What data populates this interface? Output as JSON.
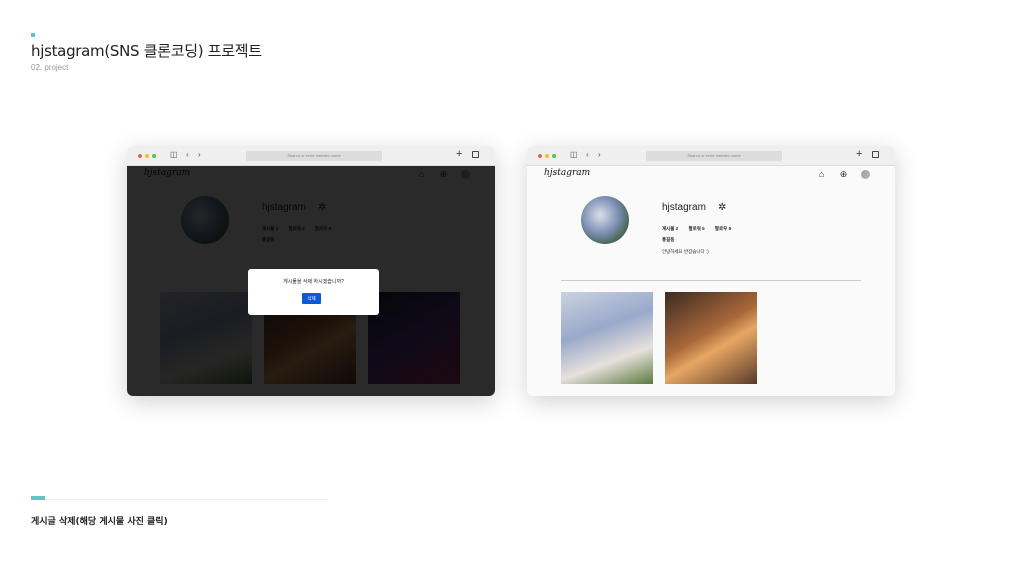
{
  "page": {
    "title": "hjstagram(SNS 클론코딩) 프로젝트",
    "subtitle": "02. project",
    "caption": "게시글 삭제(해당 게시물 사진 클릭)"
  },
  "browser": {
    "url_placeholder": "Search or enter website name"
  },
  "app": {
    "logo": "hjstagram",
    "username": "hjstagram",
    "name": "홍길동",
    "bio": "안녕하세요 반갑습니다 :)"
  },
  "left_window": {
    "stats": [
      "게시물 3",
      "팔로워 4",
      "팔로우 5"
    ],
    "name": "홍길동",
    "modal_text": "게시물을 삭제 하시겠습니까?",
    "modal_button": "삭제"
  },
  "right_window": {
    "stats": [
      "게시물 2",
      "팔로워 5",
      "팔로우 5"
    ]
  },
  "colors": {
    "accent": "#5cc6c6",
    "delete_button": "#0a5bd8"
  }
}
